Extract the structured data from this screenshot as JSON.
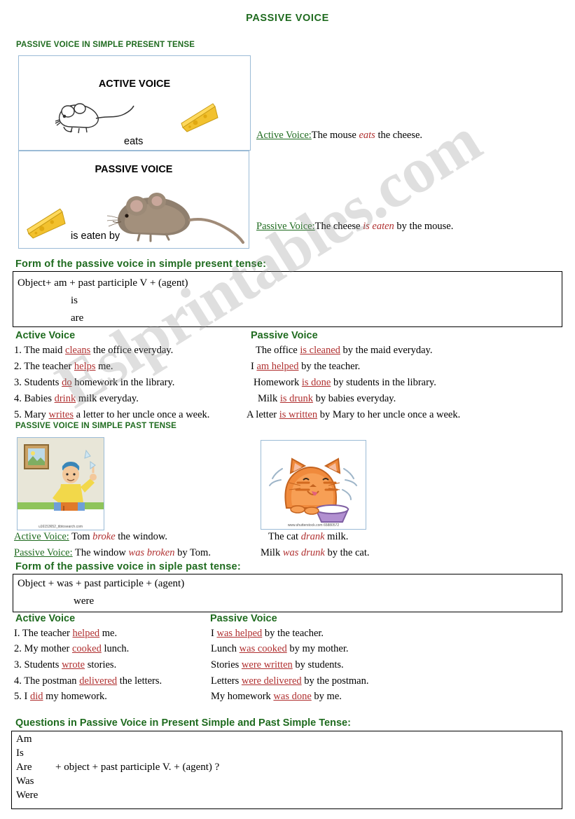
{
  "document": {
    "title": "PASSIVE VOICE",
    "watermark": "Eslprintables.com"
  },
  "section_present": {
    "heading": "PASSIVE VOICE IN SIMPLE PRESENT TENSE",
    "active_box": {
      "label": "ACTIVE VOICE",
      "verb": "eats",
      "icons": [
        "mouse-line-art",
        "cheese-wedge"
      ]
    },
    "passive_box": {
      "label": "PASSIVE VOICE",
      "verb": "is eaten by",
      "icons": [
        "cheese-wedge",
        "mouse-photo"
      ]
    },
    "examples": [
      {
        "label": "Active Voice:",
        "pre": "The mouse ",
        "verb": "eats",
        "post": " the cheese."
      },
      {
        "label": "Passive Voice:",
        "pre": "The cheese ",
        "verb": "is eaten",
        "post": " by the mouse."
      }
    ],
    "form_heading": "Form of the passive voice in simple present tense:",
    "form_lines": [
      "Object+ am + past participle V + (agent)",
      "is",
      "are"
    ]
  },
  "present_table": {
    "active_head": "Active Voice",
    "passive_head": "Passive Voice",
    "active_rows": [
      {
        "num": "1.",
        "pre": "The maid ",
        "verb": "cleans",
        "post": " the office everyday."
      },
      {
        "num": "2.",
        "pre": "The teacher ",
        "verb": "helps",
        "post": " me."
      },
      {
        "num": "3.",
        "pre": "Students ",
        "verb": "do",
        "post": " homework in the library."
      },
      {
        "num": "4.",
        "pre": "Babies ",
        "verb": "drink",
        "post": " milk everyday."
      },
      {
        "num": "5.",
        "pre": "Mary ",
        "verb": "writes",
        "post": " a letter to her uncle once a week."
      }
    ],
    "passive_rows": [
      {
        "pre": "The office ",
        "verb": "is cleaned",
        "post": " by the maid everyday."
      },
      {
        "pre": "I ",
        "verb": "am helped",
        "post": " by the teacher."
      },
      {
        "pre": "Homework ",
        "verb": "is done",
        "post": " by students in the library."
      },
      {
        "pre": "Milk ",
        "verb": "is drunk",
        "post": " by babies everyday."
      },
      {
        "pre": "A letter ",
        "verb": "is written",
        "post": " by Mary to her uncle once a week."
      }
    ]
  },
  "section_past": {
    "heading": "PASSIVE VOICE IN SIMPLE PAST TENSE",
    "left_image_caption": "u16153652_tibtosearch.com",
    "right_image_caption": "www.shutterstock.com   65880572",
    "left_examples": [
      {
        "label": "Active Voice:",
        "pre": " Tom ",
        "verb": "broke",
        "post": " the window."
      },
      {
        "label": "Passive Voice:",
        "pre": " The window ",
        "verb": "was broken",
        "post": " by Tom."
      }
    ],
    "right_examples": [
      {
        "pre": "The cat ",
        "verb": "drank",
        "post": " milk."
      },
      {
        "pre": "Milk ",
        "verb": "was drunk",
        "post": " by the cat."
      }
    ],
    "form_heading": "Form of the passive voice in siple past tense:",
    "form_lines": [
      "Object + was + past participle + (agent)",
      "were"
    ]
  },
  "past_table": {
    "active_head": "Active Voice",
    "passive_head": "Passive Voice",
    "active_rows": [
      {
        "num": "I.",
        "pre": "The teacher ",
        "verb": "helped",
        "post": " me."
      },
      {
        "num": "2.",
        "pre": "My mother ",
        "verb": "cooked",
        "post": " lunch."
      },
      {
        "num": "3.",
        "pre": "Students ",
        "verb": "wrote",
        "post": " stories."
      },
      {
        "num": "4.",
        "pre": "The postman ",
        "verb": "delivered",
        "post": " the letters."
      },
      {
        "num": "5.",
        "pre": "I ",
        "verb": "did",
        "post": " my homework."
      }
    ],
    "passive_rows": [
      {
        "pre": "I ",
        "verb": "was helped",
        "post": " by the teacher."
      },
      {
        "pre": "Lunch ",
        "verb": "was cooked",
        "post": " by my mother."
      },
      {
        "pre": "Stories ",
        "verb": "were written",
        "post": " by students."
      },
      {
        "pre": "Letters ",
        "verb": "were delivered",
        "post": " by the postman."
      },
      {
        "pre": "My homework ",
        "verb": "was done",
        "post": " by me."
      }
    ]
  },
  "section_questions": {
    "heading": "Questions in Passive Voice in Present Simple and Past Simple Tense:",
    "lines": [
      "Am",
      "Is",
      "Are",
      "Was",
      "Were"
    ],
    "pattern": "+ object + past  participle V. + (agent) ?"
  }
}
